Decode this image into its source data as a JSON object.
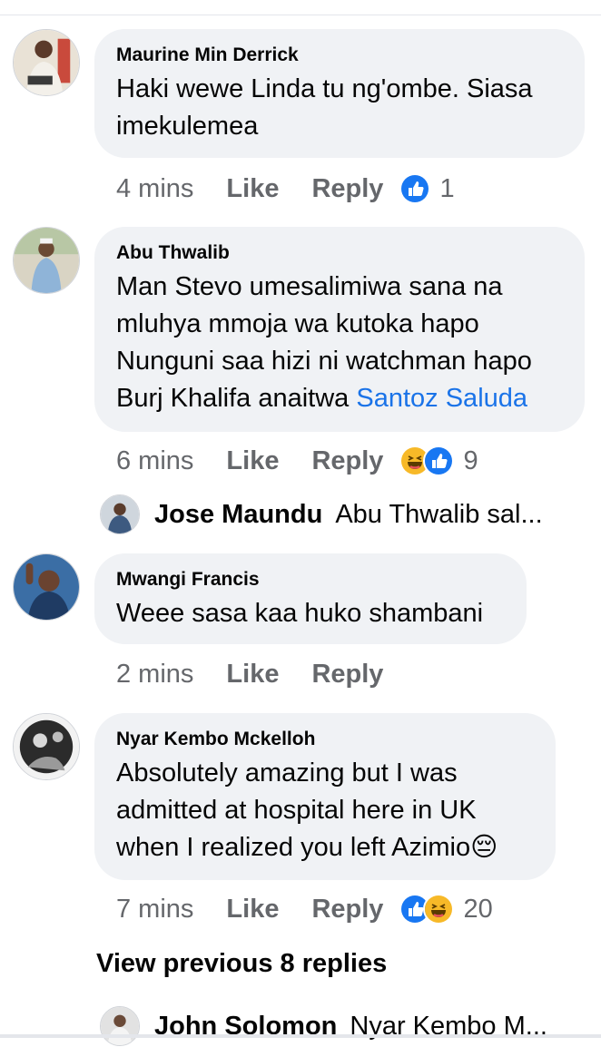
{
  "comments": [
    {
      "author": "Maurine Min Derrick",
      "text": "Haki wewe Linda tu ng'ombe.  Siasa\nimekulemea",
      "time": "4 mins",
      "like": "Like",
      "reply": "Reply",
      "reaction_count": "1"
    },
    {
      "author": "Abu Thwalib",
      "text": "Man Stevo umesalimiwa sana na\nmluhya mmoja wa kutoka hapo\nNunguni saa hizi ni watchman hapo\nBurj Khalifa anaitwa ",
      "mention": "Santoz Saluda",
      "time": "6 mins",
      "like": "Like",
      "reply": "Reply",
      "reaction_count": "9",
      "reply_preview": {
        "name": "Jose Maundu",
        "text": "Abu Thwalib sal..."
      }
    },
    {
      "author": "Mwangi Francis",
      "text": "Weee sasa kaa huko shambani",
      "time": "2 mins",
      "like": "Like",
      "reply": "Reply"
    },
    {
      "author": "Nyar Kembo Mckelloh",
      "text": "Absolutely amazing but I was\nadmitted at hospital here in UK\nwhen I realized you left Azimio",
      "emoji": "😔",
      "time": "7 mins",
      "like": "Like",
      "reply": "Reply",
      "reaction_count": "20"
    }
  ],
  "view_previous": "View previous 8 replies",
  "last_reply_preview": {
    "name": "John Solomon",
    "text": "Nyar Kembo M..."
  },
  "colors": {
    "bubble": "#f0f2f5",
    "meta": "#65676b",
    "mention": "#1a73e8",
    "like_blue": "#1877f2",
    "haha_yellow": "#f7b928"
  },
  "icons": [
    "like-reaction-icon",
    "haha-reaction-icon"
  ]
}
